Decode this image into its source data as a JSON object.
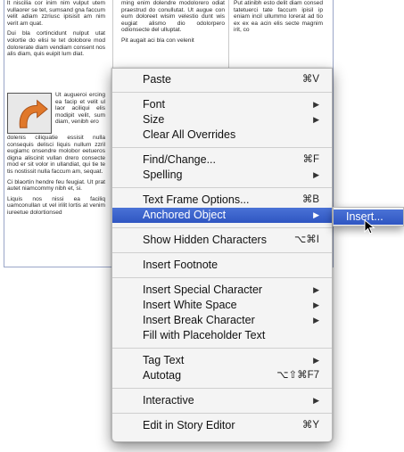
{
  "document": {
    "col1_top": [
      "lt nisciliа cor inim nim vulput utem vullaorer se tet, sumsand gna faccum velit adiam zzriusc ipisisit am nim verit am quat.",
      "Dui bla cortincidunt nulput utat volortie do elisi te tet dolobore mod dolorerate diam vendiam consent nos alis diam, quis euipit lum diat."
    ],
    "col1_wrap": "Ut augueroi ercing ea facip et velit ul laor aciliqui elis modipit velit, sum diam, venibh ero",
    "col1_under": [
      "dolenis ciliquatie essisit nulla consequis delisci liquis nullum zzril eugiamc onsendre molobor eetueros digna aliscinit vullan drero consecte mod er sit volor in ullandiat, qui tie te tis nostissit nulla faccum am, sequat.",
      "Ci blaortin hendre feu feugiat. Ut prat autet niamcommy nibh et, si.",
      "Liquis nos nissi ea faciliq uamconullan ut vel irilit lortis at venim iureetue dolortionsed"
    ],
    "col2_top": [
      "ming enim dolendre modolorero odiat praestrud do conullutat. Ut augue con eum doloreet wisim velestio dunt wis eugiat alismo dio odolorpero odionsecte del ulluptat.",
      "Pit augait aci bla con velenit"
    ],
    "col3_top": [
      "Put atinibh esto delit diam consed tatetuerci tate faccum ipisil ip eniam incil ullummo lorerat ad tio ex ex ea acin elis secte magnim irit, co"
    ]
  },
  "menu": {
    "items": [
      {
        "label": "Paste",
        "shortcut": "⌘V",
        "submenu": false
      },
      {
        "separator": true
      },
      {
        "label": "Font",
        "shortcut": "",
        "submenu": true
      },
      {
        "label": "Size",
        "shortcut": "",
        "submenu": true
      },
      {
        "label": "Clear All Overrides",
        "shortcut": "",
        "submenu": false
      },
      {
        "separator": true
      },
      {
        "label": "Find/Change...",
        "shortcut": "⌘F",
        "submenu": false
      },
      {
        "label": "Spelling",
        "shortcut": "",
        "submenu": true
      },
      {
        "separator": true
      },
      {
        "label": "Text Frame Options...",
        "shortcut": "⌘B",
        "submenu": false
      },
      {
        "label": "Anchored Object",
        "shortcut": "",
        "submenu": true,
        "highlighted": true
      },
      {
        "separator": true
      },
      {
        "label": "Show Hidden Characters",
        "shortcut": "⌥⌘I",
        "submenu": false
      },
      {
        "separator": true
      },
      {
        "label": "Insert Footnote",
        "shortcut": "",
        "submenu": false
      },
      {
        "separator": true
      },
      {
        "label": "Insert Special Character",
        "shortcut": "",
        "submenu": true
      },
      {
        "label": "Insert White Space",
        "shortcut": "",
        "submenu": true
      },
      {
        "label": "Insert Break Character",
        "shortcut": "",
        "submenu": true
      },
      {
        "label": "Fill with Placeholder Text",
        "shortcut": "",
        "submenu": false
      },
      {
        "separator": true
      },
      {
        "label": "Tag Text",
        "shortcut": "",
        "submenu": true
      },
      {
        "label": "Autotag",
        "shortcut": "⌥⇧⌘F7",
        "submenu": false
      },
      {
        "separator": true
      },
      {
        "label": "Interactive",
        "shortcut": "",
        "submenu": true
      },
      {
        "separator": true
      },
      {
        "label": "Edit in Story Editor",
        "shortcut": "⌘Y",
        "submenu": false
      }
    ]
  },
  "submenu": {
    "items": [
      {
        "label": "Insert...",
        "highlighted": true
      }
    ]
  },
  "colors": {
    "highlight": "#3a63cc",
    "anchored_arrow": "#e0782a"
  },
  "icons": {
    "anchored_image": "curved-arrow-icon",
    "cursor": "mouse-pointer-icon"
  }
}
